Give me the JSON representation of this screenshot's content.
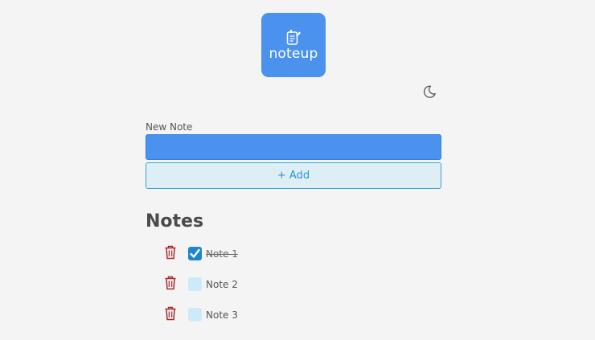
{
  "app": {
    "logo_text": "noteup",
    "theme_toggle_icon": "moon-icon"
  },
  "form": {
    "label": "New Note",
    "input_value": "",
    "add_label": "+ Add"
  },
  "notes": {
    "title": "Notes",
    "items": [
      {
        "text": "Note 1",
        "done": true
      },
      {
        "text": "Note 2",
        "done": false
      },
      {
        "text": "Note 3",
        "done": false
      }
    ]
  },
  "colors": {
    "accent": "#4b92ef",
    "add_button_text": "#2a96d4",
    "trash": "#b0262b",
    "checkbox_checked": "#1e86cf",
    "checkbox_unchecked": "#cdeafb"
  }
}
